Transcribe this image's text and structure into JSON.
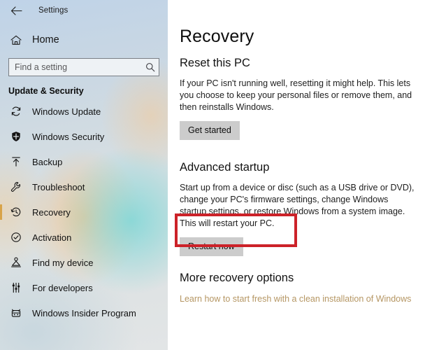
{
  "window": {
    "app_title": "Settings",
    "back_icon": "back-arrow-icon"
  },
  "sidebar": {
    "home": {
      "label": "Home",
      "icon": "home-icon"
    },
    "search": {
      "placeholder": "Find a setting",
      "value": "",
      "icon": "search-icon"
    },
    "group_header": "Update & Security",
    "items": [
      {
        "label": "Windows Update",
        "icon": "sync-refresh-icon",
        "selected": false
      },
      {
        "label": "Windows Security",
        "icon": "shield-icon",
        "selected": false
      },
      {
        "label": "Backup",
        "icon": "upload-arrow-icon",
        "selected": false
      },
      {
        "label": "Troubleshoot",
        "icon": "wrench-icon",
        "selected": false
      },
      {
        "label": "Recovery",
        "icon": "clock-history-icon",
        "selected": true
      },
      {
        "label": "Activation",
        "icon": "check-circle-icon",
        "selected": false
      },
      {
        "label": "Find my device",
        "icon": "location-person-icon",
        "selected": false
      },
      {
        "label": "For developers",
        "icon": "sliders-icon",
        "selected": false
      },
      {
        "label": "Windows Insider Program",
        "icon": "ninjacat-icon",
        "selected": false
      }
    ]
  },
  "main": {
    "page_title": "Recovery",
    "sections": [
      {
        "title": "Reset this PC",
        "body": "If your PC isn't running well, resetting it might help. This lets you choose to keep your personal files or remove them, and then reinstalls Windows.",
        "button": "Get started"
      },
      {
        "title": "Advanced startup",
        "body": "Start up from a device or disc (such as a USB drive or DVD), change your PC's firmware settings, change Windows startup settings, or restore Windows from a system image. This will restart your PC.",
        "button": "Restart now"
      },
      {
        "title": "More recovery options",
        "link": "Learn how to start fresh with a clean installation of Windows"
      }
    ]
  },
  "annotation": {
    "color": "#cc2229",
    "target": "Restart now"
  }
}
